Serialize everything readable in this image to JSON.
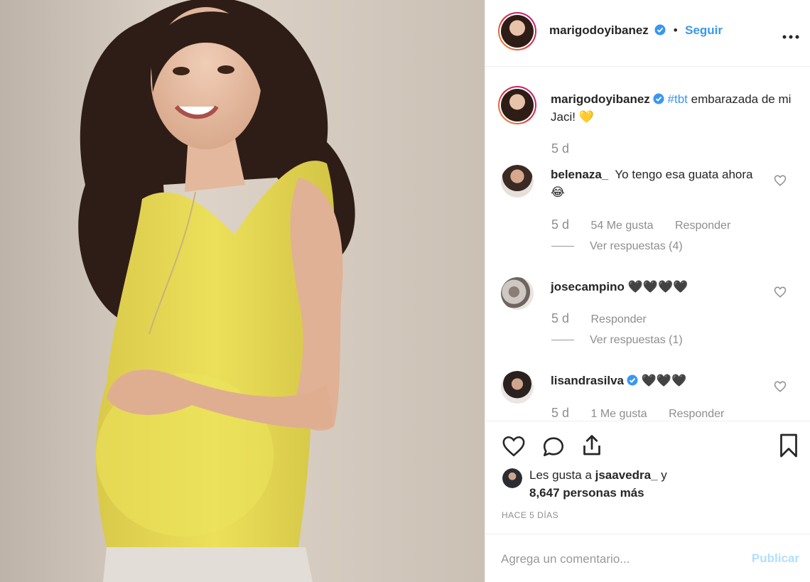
{
  "post_author": {
    "username": "marigodoyibanez",
    "follow_label": "Seguir",
    "separator": "•"
  },
  "caption": {
    "username": "marigodoyibanez",
    "hashtag": "#tbt",
    "text": " embarazada de mi Jaci! 💛",
    "time": "5 d"
  },
  "comments": [
    {
      "username": "belenaza_",
      "text": "Yo tengo esa guata ahora 😂",
      "time": "5 d",
      "likes": "54 Me gusta",
      "reply_label": "Responder",
      "view_replies": "Ver respuestas (4)"
    },
    {
      "username": "josecampino",
      "text": "🖤🖤🖤🖤",
      "time": "5 d",
      "reply_label": "Responder",
      "view_replies": "Ver respuestas (1)"
    },
    {
      "username": "lisandrasilva",
      "text": "🖤🖤🖤",
      "time": "5 d",
      "likes": "1 Me gusta",
      "reply_label": "Responder"
    }
  ],
  "likes_summary": {
    "prefix": "Les gusta a ",
    "user": "jsaavedra_",
    "middle": " y",
    "count_text": "8,647 personas más"
  },
  "posted_ago": "HACE 5 DÍAS",
  "add_comment": {
    "placeholder": "Agrega un comentario...",
    "publish_label": "Publicar"
  },
  "colors": {
    "link_blue": "#3897f0",
    "muted_gray": "#8e8e8e",
    "publish_disabled": "#b2dffc",
    "shirt_yellow": "#e9dc54"
  }
}
